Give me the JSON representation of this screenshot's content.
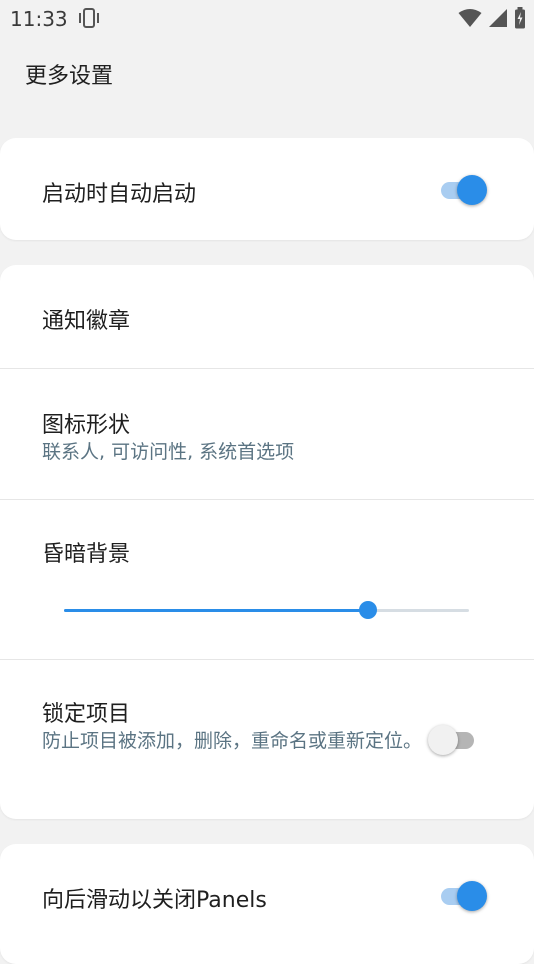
{
  "status_bar": {
    "time": "11:33",
    "icons": [
      "vibrate-icon",
      "wifi-icon",
      "cell-signal-icon",
      "battery-charging-icon"
    ]
  },
  "page": {
    "title": "更多设置"
  },
  "settings": {
    "auto_start": {
      "title": "启动时自动启动",
      "enabled": true
    },
    "notification_badge": {
      "title": "通知徽章"
    },
    "icon_shape": {
      "title": "图标形状",
      "summary": "联系人, 可访问性, 系统首选项"
    },
    "dim_background": {
      "title": "昏暗背景",
      "level_percent": 75
    },
    "lock_items": {
      "title": "锁定项目",
      "summary": "防止项目被添加，删除，重命名或重新定位。",
      "enabled": false
    },
    "swipe_close_panels": {
      "title": "向后滑动以关闭Panels",
      "enabled": true
    }
  },
  "colors": {
    "accent": "#2a8de8",
    "background": "#f2f2f2",
    "card": "#ffffff",
    "summary_text": "#5b7483"
  }
}
